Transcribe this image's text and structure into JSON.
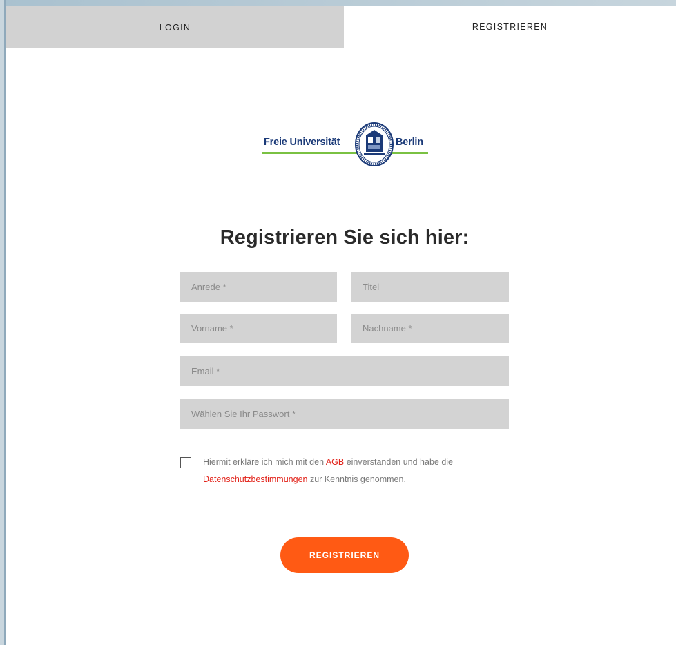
{
  "tabs": {
    "login_label": "LOGIN",
    "register_label": "REGISTRIEREN",
    "active": "register"
  },
  "logo": {
    "left_word": "Freie Universität",
    "right_word": "Berlin",
    "seal_icon": "university-seal-icon",
    "colors": {
      "text": "#1b3a78",
      "underline": "#7ac142"
    }
  },
  "form": {
    "heading": "Registrieren Sie sich hier:",
    "fields": {
      "anrede_placeholder": "Anrede *",
      "titel_placeholder": "Titel",
      "vorname_placeholder": "Vorname *",
      "nachname_placeholder": "Nachname *",
      "email_placeholder": "Email *",
      "password_placeholder": "Wählen Sie Ihr Passwort *"
    },
    "consent": {
      "checked": false,
      "text_part1": "Hiermit erkläre ich mich mit den ",
      "agb_link": "AGB",
      "text_part2": " einverstanden und habe die ",
      "privacy_link": "Datenschutzbestimmungen",
      "text_part3": " zur Kenntnis genommen."
    },
    "submit_label": "REGISTRIEREN"
  },
  "colors": {
    "accent": "#ff5a14",
    "link": "#e2231a",
    "field_bg": "#d3d3d3",
    "inactive_tab_bg": "#d2d2d2"
  }
}
